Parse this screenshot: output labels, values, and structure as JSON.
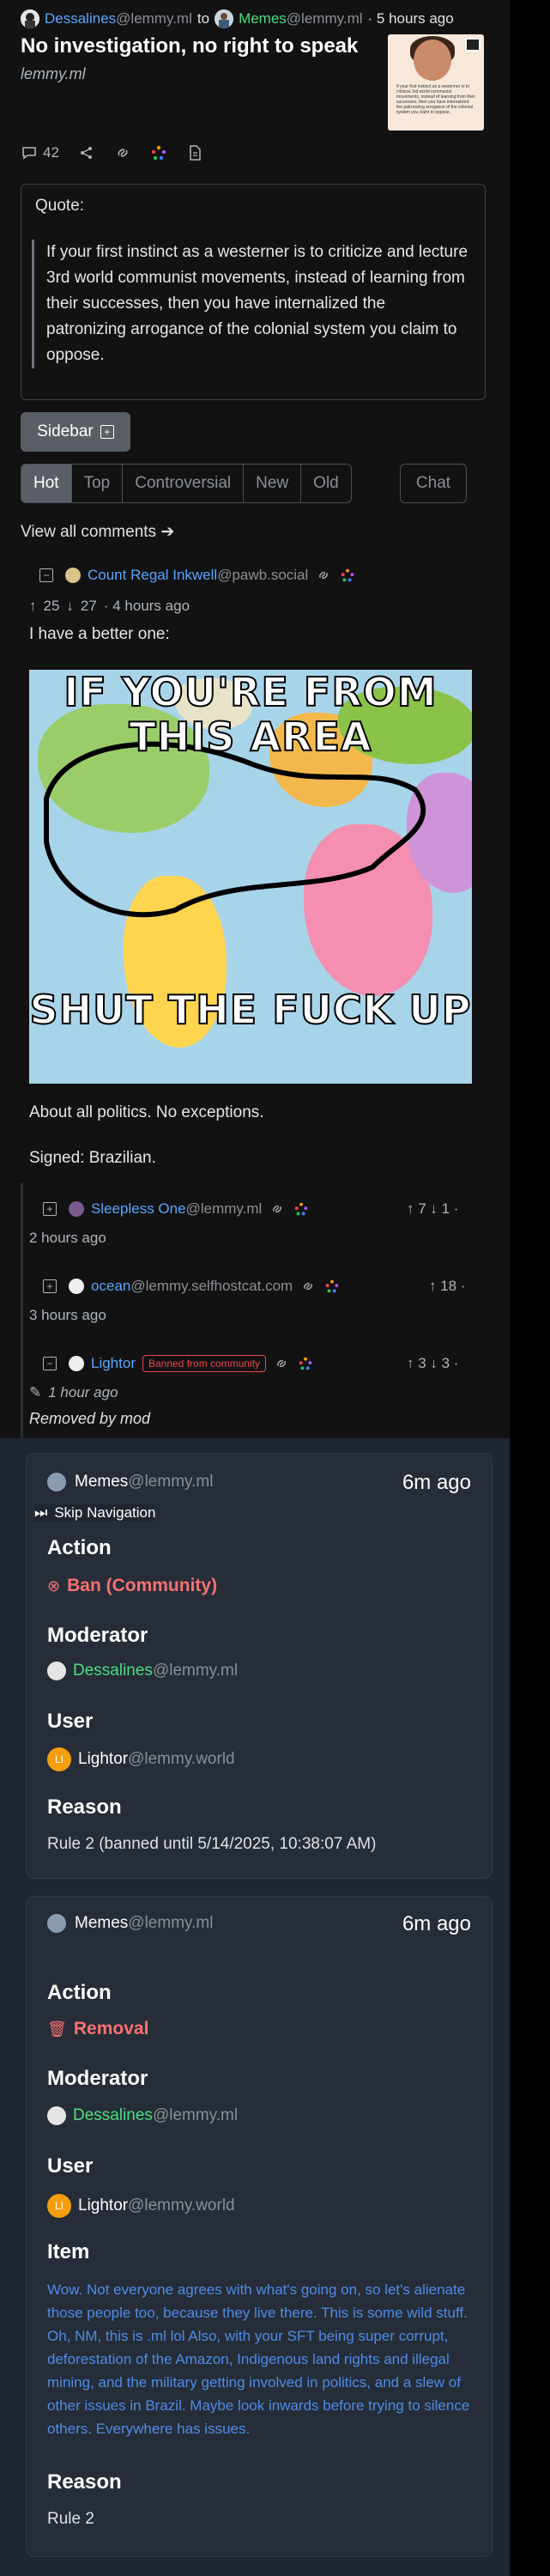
{
  "post": {
    "author": "Dessalines",
    "author_instance": "@lemmy.ml",
    "to_label": "to",
    "community": "Memes",
    "community_instance": "@lemmy.ml",
    "time": "· 5 hours ago",
    "title": "No investigation, no right to speak",
    "domain": "lemmy.ml",
    "comment_count": "42",
    "thumbnail_text": "If your first instinct as a westerner is to criticize 3rd world communist movements, instead of learning from their successes, then you have internalized the patronizing arrogance of the colonial system you claim to oppose."
  },
  "quote": {
    "label": "Quote:",
    "text": "If your first instinct as a westerner is to criticize and lecture 3rd world communist movements, instead of learning from their successes, then you have internalized the patronizing arrogance of the colonial system you claim to oppose."
  },
  "controls": {
    "sidebar_label": "Sidebar",
    "sorts": [
      "Hot",
      "Top",
      "Controversial",
      "New",
      "Old"
    ],
    "chat_label": "Chat",
    "view_all": "View all comments ➔"
  },
  "comments": [
    {
      "author": "Count Regal Inkwell",
      "instance": "@pawb.social",
      "votes_up": "25",
      "votes_down": "27",
      "time": "· 4 hours ago",
      "text1": "I have a better one:",
      "meme_top": "IF YOU'RE FROM THIS AREA",
      "meme_bottom": "SHUT THE FUCK UP",
      "text2": "About all politics. No exceptions.",
      "text3": "Signed: Brazilian."
    },
    {
      "author": "Sleepless One",
      "instance": "@lemmy.ml",
      "votes": "↑ 7 ↓ 1 ·",
      "time": "2 hours ago"
    },
    {
      "author": "ocean",
      "instance": "@lemmy.selfhostcat.com",
      "votes": "↑ 18 ·",
      "time": "3 hours ago"
    },
    {
      "author": "Lightor",
      "badge": "Banned from community",
      "votes": "↑ 3 ↓ 3 ·",
      "time": "1 hour ago",
      "removed": "Removed by mod"
    }
  ],
  "modlog": {
    "skip_nav": "Skip Navigation",
    "cards": [
      {
        "community": "Memes",
        "community_instance": "@lemmy.ml",
        "time": "6m ago",
        "action_label": "Action",
        "action": "Ban (Community)",
        "moderator_label": "Moderator",
        "moderator": "Dessalines",
        "moderator_instance": "@lemmy.ml",
        "user_label": "User",
        "user": "Lightor",
        "user_instance": "@lemmy.world",
        "user_initials": "LI",
        "reason_label": "Reason",
        "reason": "Rule 2 (banned until 5/14/2025, 10:38:07 AM)"
      },
      {
        "community": "Memes",
        "community_instance": "@lemmy.ml",
        "time": "6m ago",
        "action_label": "Action",
        "action": "Removal",
        "moderator_label": "Moderator",
        "moderator": "Dessalines",
        "moderator_instance": "@lemmy.ml",
        "user_label": "User",
        "user": "Lightor",
        "user_instance": "@lemmy.world",
        "user_initials": "LI",
        "item_label": "Item",
        "item": "Wow. Not everyone agrees with what's going on, so let's alienate those people too, because they live there. This is some wild stuff. Oh, NM, this is .ml lol Also, with your SFT being super corrupt, deforestation of the Amazon, Indigenous land rights and illegal mining, and the military getting involved in politics, and a slew of other issues in Brazil. Maybe look inwards before trying to silence others. Everywhere has issues.",
        "reason_label": "Reason",
        "reason": "Rule 2"
      }
    ]
  },
  "colors": {
    "link": "#58a6ff",
    "accent_green": "#4ade80",
    "danger": "#f87171",
    "item_blue": "#4d8ce8"
  }
}
